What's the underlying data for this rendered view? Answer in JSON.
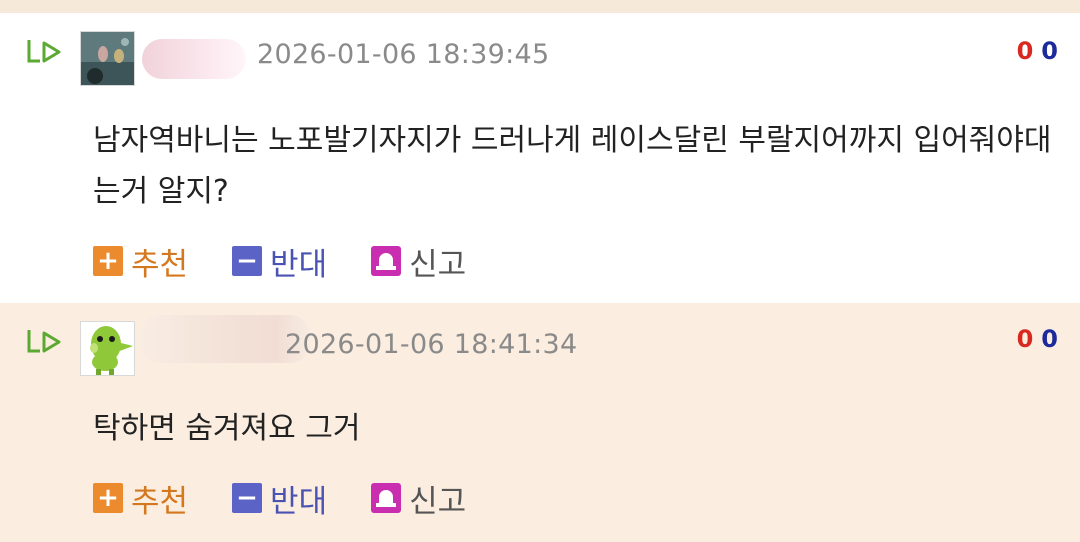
{
  "comments": [
    {
      "datetime": "2026-01-06 18:39:45",
      "votes_up": "0",
      "votes_down": "0",
      "body": "남자역바니는 노포발기자지가 드러나게 레이스달린 부랄지어까지 입어줘야대는거 알지?",
      "actions": {
        "recommend": "추천",
        "oppose": "반대",
        "report": "신고"
      }
    },
    {
      "datetime": "2026-01-06 18:41:34",
      "votes_up": "0",
      "votes_down": "0",
      "body": "탁하면 숨겨져요 그거",
      "actions": {
        "recommend": "추천",
        "oppose": "반대",
        "report": "신고"
      }
    }
  ]
}
